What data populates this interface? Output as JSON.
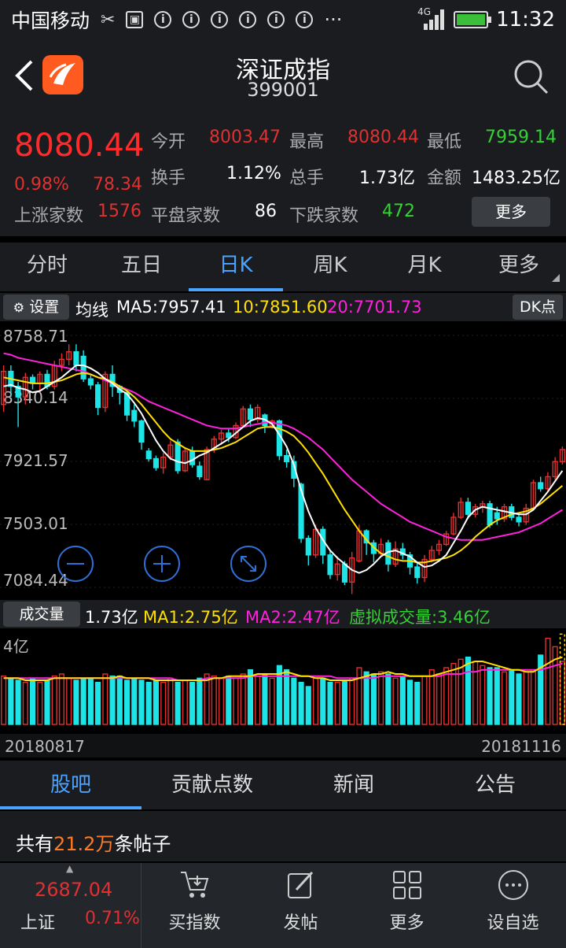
{
  "status_bar": {
    "carrier": "中国移动",
    "network": "4G",
    "time": "11:32"
  },
  "header": {
    "title": "深证成指",
    "code": "399001"
  },
  "quote": {
    "price": "8080.44",
    "change_pct": "0.98%",
    "change": "78.34",
    "open_label": "今开",
    "open": "8003.47",
    "high_label": "最高",
    "high": "8080.44",
    "low_label": "最低",
    "low": "7959.14",
    "turnover_label": "换手",
    "turnover": "1.12%",
    "volume_label": "总手",
    "volume": "1.73亿",
    "amount_label": "金额",
    "amount": "1483.25亿",
    "up_label": "上涨家数",
    "up": "1576",
    "flat_label": "平盘家数",
    "flat": "86",
    "down_label": "下跌家数",
    "down": "472",
    "more_label": "更多"
  },
  "tabs": [
    "分时",
    "五日",
    "日K",
    "周K",
    "月K",
    "更多"
  ],
  "ma_bar": {
    "settings_label": "设置",
    "prefix": "均线",
    "ma5": "MA5:7957.41",
    "ma10": "10:7851.60",
    "ma20": "20:7701.73",
    "dk_label": "DK点"
  },
  "volume_bar": {
    "label": "成交量",
    "value": "1.73亿",
    "ma1": "MA1:2.75亿",
    "ma2": "MA2:2.47亿",
    "virtual": "虚拟成交量:3.46亿",
    "axis_top": "4亿"
  },
  "dates": {
    "start": "20180817",
    "end": "20181116"
  },
  "chart_data": {
    "type": "candlestick",
    "y_ticks": [
      "8758.71",
      "8340.14",
      "7921.57",
      "7503.01",
      "7084.44"
    ],
    "y_range": [
      7084.44,
      8758.71
    ],
    "candles": [
      [
        8300,
        8520,
        8560,
        8250
      ],
      [
        8520,
        8420,
        8560,
        8350
      ],
      [
        8420,
        8350,
        8450,
        8150
      ],
      [
        8350,
        8480,
        8510,
        8300
      ],
      [
        8480,
        8440,
        8500,
        8400
      ],
      [
        8440,
        8500,
        8520,
        8380
      ],
      [
        8500,
        8420,
        8530,
        8400
      ],
      [
        8420,
        8560,
        8590,
        8400
      ],
      [
        8560,
        8600,
        8640,
        8520
      ],
      [
        8600,
        8650,
        8700,
        8560
      ],
      [
        8650,
        8560,
        8700,
        8520
      ],
      [
        8620,
        8470,
        8660,
        8450
      ],
      [
        8470,
        8430,
        8500,
        8400
      ],
      [
        8430,
        8280,
        8450,
        8230
      ],
      [
        8280,
        8500,
        8520,
        8250
      ],
      [
        8500,
        8420,
        8560,
        8350
      ],
      [
        8420,
        8380,
        8430,
        8300
      ],
      [
        8380,
        8230,
        8390,
        8190
      ],
      [
        8260,
        8190,
        8300,
        8150
      ],
      [
        8190,
        8050,
        8200,
        8000
      ],
      [
        7990,
        7940,
        8010,
        7920
      ],
      [
        7940,
        7880,
        7960,
        7860
      ],
      [
        7880,
        7950,
        7980,
        7840
      ],
      [
        7950,
        8030,
        8060,
        7930
      ],
      [
        8050,
        7860,
        8070,
        7840
      ],
      [
        7860,
        7990,
        8010,
        7850
      ],
      [
        7990,
        7900,
        8020,
        7880
      ],
      [
        7890,
        7820,
        7920,
        7800
      ],
      [
        7800,
        8000,
        8020,
        7800
      ],
      [
        8000,
        8070,
        8090,
        7980
      ],
      [
        8070,
        8110,
        8130,
        8030
      ],
      [
        8110,
        8080,
        8140,
        8050
      ],
      [
        8080,
        8160,
        8180,
        8070
      ],
      [
        8160,
        8270,
        8290,
        8150
      ],
      [
        8270,
        8200,
        8300,
        8150
      ],
      [
        8200,
        8280,
        8300,
        8180
      ],
      [
        8230,
        8160,
        8240,
        8110
      ],
      [
        8160,
        8190,
        8200,
        8140
      ],
      [
        8190,
        7960,
        8200,
        7930
      ],
      [
        7960,
        7920,
        8000,
        7880
      ],
      [
        7920,
        7810,
        7960,
        7750
      ],
      [
        7770,
        7410,
        7780,
        7380
      ],
      [
        7410,
        7300,
        7430,
        7230
      ],
      [
        7300,
        7470,
        7500,
        7280
      ],
      [
        7470,
        7300,
        7490,
        7240
      ],
      [
        7300,
        7170,
        7330,
        7140
      ],
      [
        7170,
        7240,
        7290,
        7130
      ],
      [
        7240,
        7120,
        7260,
        7100
      ],
      [
        7120,
        7280,
        7320,
        7040
      ],
      [
        7260,
        7460,
        7500,
        7250
      ],
      [
        7460,
        7380,
        7470,
        7300
      ],
      [
        7380,
        7310,
        7400,
        7250
      ],
      [
        7310,
        7370,
        7410,
        7290
      ],
      [
        7380,
        7240,
        7400,
        7190
      ],
      [
        7240,
        7340,
        7390,
        7220
      ],
      [
        7340,
        7300,
        7380,
        7270
      ],
      [
        7300,
        7220,
        7320,
        7170
      ],
      [
        7220,
        7150,
        7250,
        7110
      ],
      [
        7150,
        7270,
        7300,
        7120
      ],
      [
        7270,
        7330,
        7360,
        7250
      ],
      [
        7330,
        7370,
        7400,
        7300
      ],
      [
        7370,
        7440,
        7460,
        7360
      ],
      [
        7440,
        7550,
        7580,
        7430
      ],
      [
        7550,
        7650,
        7680,
        7540
      ],
      [
        7650,
        7570,
        7680,
        7540
      ],
      [
        7570,
        7620,
        7640,
        7550
      ],
      [
        7620,
        7640,
        7660,
        7580
      ],
      [
        7640,
        7500,
        7660,
        7480
      ],
      [
        7580,
        7540,
        7620,
        7500
      ],
      [
        7540,
        7620,
        7640,
        7520
      ],
      [
        7620,
        7550,
        7640,
        7530
      ],
      [
        7550,
        7520,
        7570,
        7490
      ],
      [
        7520,
        7610,
        7640,
        7500
      ],
      [
        7610,
        7780,
        7800,
        7600
      ],
      [
        7780,
        7740,
        7820,
        7720
      ],
      [
        7740,
        7820,
        7850,
        7720
      ],
      [
        7820,
        7920,
        7950,
        7800
      ],
      [
        7920,
        8000,
        8020,
        7900
      ]
    ],
    "ma5": [
      8420,
      8430,
      8410,
      8400,
      8380,
      8390,
      8420,
      8450,
      8480,
      8520,
      8560,
      8560,
      8540,
      8510,
      8470,
      8440,
      8400,
      8370,
      8310,
      8240,
      8150,
      8060,
      7990,
      7940,
      7920,
      7910,
      7930,
      7960,
      7980,
      8010,
      8040,
      8070,
      8110,
      8150,
      8190,
      8210,
      8200,
      8170,
      8100,
      8020,
      7900,
      7730,
      7590,
      7480,
      7400,
      7330,
      7280,
      7240,
      7200,
      7180,
      7200,
      7240,
      7290,
      7320,
      7330,
      7310,
      7290,
      7250,
      7220,
      7230,
      7260,
      7300,
      7380,
      7460,
      7550,
      7600,
      7620,
      7610,
      7600,
      7590,
      7580,
      7570,
      7570,
      7600,
      7660,
      7720,
      7790,
      7860
    ],
    "ma10": [
      8480,
      8470,
      8460,
      8450,
      8440,
      8440,
      8440,
      8450,
      8460,
      8480,
      8500,
      8510,
      8500,
      8480,
      8470,
      8450,
      8420,
      8390,
      8350,
      8300,
      8240,
      8180,
      8120,
      8070,
      8040,
      8010,
      7990,
      7990,
      7990,
      8000,
      8010,
      8030,
      8050,
      8080,
      8110,
      8140,
      8150,
      8150,
      8140,
      8120,
      8090,
      8040,
      7980,
      7910,
      7840,
      7760,
      7680,
      7600,
      7530,
      7460,
      7400,
      7350,
      7310,
      7290,
      7270,
      7260,
      7260,
      7250,
      7250,
      7260,
      7270,
      7280,
      7300,
      7330,
      7370,
      7420,
      7460,
      7500,
      7530,
      7550,
      7570,
      7580,
      7590,
      7610,
      7640,
      7680,
      7720,
      7760
    ],
    "ma20": [
      8640,
      8630,
      8610,
      8600,
      8590,
      8580,
      8570,
      8560,
      8550,
      8540,
      8530,
      8520,
      8500,
      8480,
      8460,
      8440,
      8420,
      8400,
      8380,
      8350,
      8320,
      8300,
      8280,
      8260,
      8240,
      8220,
      8200,
      8180,
      8160,
      8150,
      8140,
      8140,
      8140,
      8150,
      8160,
      8170,
      8180,
      8180,
      8170,
      8160,
      8140,
      8110,
      8080,
      8040,
      8000,
      7950,
      7900,
      7850,
      7800,
      7760,
      7720,
      7680,
      7640,
      7610,
      7580,
      7550,
      7520,
      7500,
      7480,
      7460,
      7440,
      7420,
      7410,
      7400,
      7400,
      7400,
      7400,
      7410,
      7420,
      7430,
      7440,
      7450,
      7470,
      7490,
      7510,
      7540,
      7570,
      7600
    ],
    "volumes": [
      2.3,
      2.2,
      2.1,
      2.0,
      2.2,
      2.0,
      2.1,
      2.3,
      2.4,
      2.2,
      2.1,
      2.2,
      2.2,
      2.0,
      2.4,
      2.3,
      2.3,
      2.1,
      2.2,
      2.1,
      2.0,
      2.1,
      2.0,
      2.2,
      2.0,
      2.1,
      2.0,
      2.2,
      2.4,
      2.3,
      2.2,
      2.3,
      2.2,
      2.4,
      2.6,
      2.3,
      2.4,
      2.2,
      2.8,
      2.6,
      2.2,
      2.0,
      1.8,
      2.2,
      2.2,
      2.0,
      2.0,
      2.1,
      2.2,
      2.7,
      2.5,
      2.4,
      2.5,
      2.4,
      2.2,
      2.3,
      2.1,
      2.0,
      2.3,
      2.6,
      2.4,
      2.7,
      2.9,
      3.1,
      3.2,
      3.0,
      2.8,
      2.7,
      2.7,
      2.5,
      2.6,
      2.4,
      2.5,
      2.6,
      3.3,
      4.1,
      3.7,
      3.0
    ],
    "vma1": [
      2.2,
      2.2,
      2.2,
      2.1,
      2.1,
      2.1,
      2.1,
      2.2,
      2.2,
      2.2,
      2.2,
      2.2,
      2.2,
      2.2,
      2.2,
      2.2,
      2.3,
      2.2,
      2.2,
      2.2,
      2.2,
      2.1,
      2.1,
      2.1,
      2.1,
      2.1,
      2.1,
      2.1,
      2.1,
      2.2,
      2.2,
      2.3,
      2.3,
      2.3,
      2.3,
      2.4,
      2.4,
      2.4,
      2.4,
      2.5,
      2.4,
      2.3,
      2.3,
      2.2,
      2.2,
      2.1,
      2.1,
      2.1,
      2.1,
      2.2,
      2.3,
      2.4,
      2.4,
      2.5,
      2.4,
      2.4,
      2.3,
      2.3,
      2.3,
      2.3,
      2.4,
      2.5,
      2.6,
      2.7,
      2.9,
      3.0,
      3.0,
      2.9,
      2.8,
      2.7,
      2.6,
      2.6,
      2.5,
      2.5,
      2.7,
      2.9,
      3.1,
      3.2
    ],
    "vma2": [
      2.2,
      2.2,
      2.2,
      2.2,
      2.2,
      2.2,
      2.2,
      2.2,
      2.2,
      2.2,
      2.2,
      2.2,
      2.2,
      2.2,
      2.2,
      2.2,
      2.2,
      2.2,
      2.2,
      2.2,
      2.2,
      2.2,
      2.2,
      2.2,
      2.1,
      2.1,
      2.1,
      2.1,
      2.2,
      2.2,
      2.2,
      2.2,
      2.2,
      2.2,
      2.3,
      2.3,
      2.3,
      2.3,
      2.3,
      2.3,
      2.3,
      2.3,
      2.3,
      2.3,
      2.3,
      2.3,
      2.2,
      2.2,
      2.2,
      2.2,
      2.2,
      2.2,
      2.3,
      2.3,
      2.3,
      2.3,
      2.3,
      2.3,
      2.3,
      2.3,
      2.3,
      2.4,
      2.4,
      2.4,
      2.5,
      2.5,
      2.6,
      2.6,
      2.6,
      2.6,
      2.6,
      2.6,
      2.6,
      2.6,
      2.6,
      2.7,
      2.8,
      2.9
    ],
    "volume_max": 4.5
  },
  "bottom_tabs": [
    "股吧",
    "贡献点数",
    "新闻",
    "公告"
  ],
  "posts": {
    "prefix": "共有",
    "count": "21.2万",
    "suffix": "条帖子"
  },
  "bottom_nav": {
    "index_value": "2687.04",
    "index_name": "上证",
    "index_pct": "0.71%",
    "items": [
      {
        "label": "买指数",
        "icon": "cart-icon"
      },
      {
        "label": "发帖",
        "icon": "edit-icon"
      },
      {
        "label": "更多",
        "icon": "grid-icon"
      },
      {
        "label": "设自选",
        "icon": "ellipsis-icon"
      }
    ]
  },
  "colors": {
    "up": "#e23030",
    "down": "#1de4e6",
    "ma5": "#ffffff",
    "ma10": "#ffe000",
    "ma20": "#ff22dd",
    "accent": "#4aa3ff"
  }
}
